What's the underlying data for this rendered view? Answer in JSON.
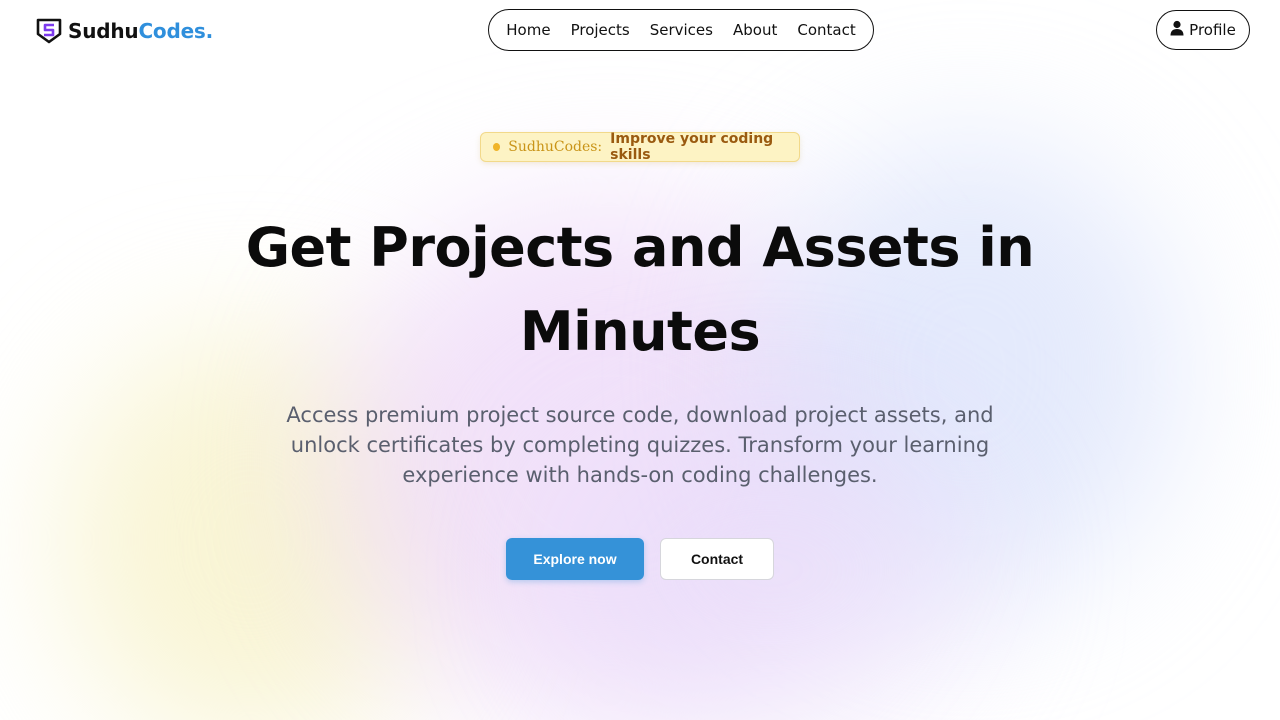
{
  "brand": {
    "name_part1": "Sudhu",
    "name_part2": "Codes.",
    "accent_color": "#2f8fdc",
    "logo_icon": "shield-s-logo-icon"
  },
  "nav": {
    "items": [
      {
        "label": "Home"
      },
      {
        "label": "Projects"
      },
      {
        "label": "Services"
      },
      {
        "label": "About"
      },
      {
        "label": "Contact"
      }
    ]
  },
  "profile": {
    "label": "Profile",
    "icon": "user-icon"
  },
  "badge": {
    "brand": "SudhuCodes:",
    "message": "Improve your coding skills",
    "dot_color": "#f0b429"
  },
  "hero": {
    "title_line1": "Get Projects and Assets in",
    "title_line2": "Minutes",
    "description_line1": "Access premium project source code, download project assets, and",
    "description_line2": "unlock certificates by completing quizzes. Transform your learning",
    "description_line3": "experience with hands-on coding challenges."
  },
  "cta": {
    "primary_label": "Explore now",
    "primary_color": "#3592d8",
    "secondary_label": "Contact"
  }
}
